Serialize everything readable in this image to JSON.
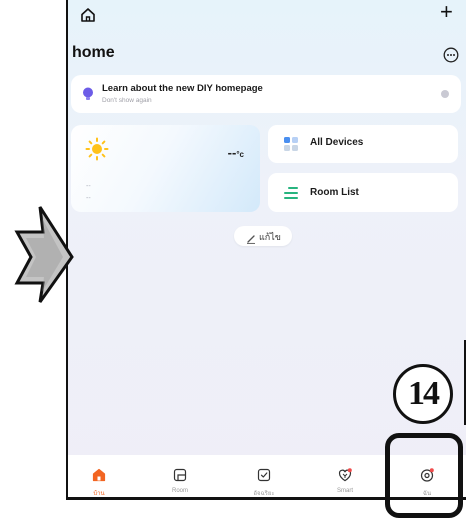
{
  "top_bar": {
    "home_icon": "home-outline-icon",
    "add_icon": "plus-icon",
    "add_label": "+"
  },
  "header": {
    "title": "home",
    "more_icon": "more-circle-icon"
  },
  "banner": {
    "icon": "lightbulb-icon",
    "title": "Learn about the new DIY homepage",
    "subtitle": "Don't show again",
    "close_icon": "close-dot-icon"
  },
  "weather": {
    "icon": "sun-icon",
    "temperature": "--",
    "unit": "°c",
    "line1": "--",
    "line2": "--"
  },
  "shortcuts": [
    {
      "label": "All Devices",
      "icon": "grid-icon"
    },
    {
      "label": "Room List",
      "icon": "list-icon"
    }
  ],
  "edit": {
    "icon": "pencil-icon",
    "label": "แก้ไข"
  },
  "tabs": [
    {
      "label": "บ้าน",
      "icon": "home-icon",
      "active": true,
      "badge": false
    },
    {
      "label": "Room",
      "icon": "room-icon",
      "active": false,
      "badge": false
    },
    {
      "label": "อัจฉริยะ",
      "icon": "scene-icon",
      "active": false,
      "badge": false
    },
    {
      "label": "Smart",
      "icon": "smart-icon",
      "active": false,
      "badge": true
    },
    {
      "label": "ฉัน",
      "icon": "me-icon",
      "active": false,
      "badge": true
    }
  ],
  "annotations": {
    "pointer_icon": "arrow-star-icon",
    "step_number": "14"
  },
  "colors": {
    "accent": "#f26522",
    "badge": "#f04b4b",
    "bulb": "#6c5ce7",
    "grid": "#4a8ff0",
    "list": "#27b47f"
  }
}
